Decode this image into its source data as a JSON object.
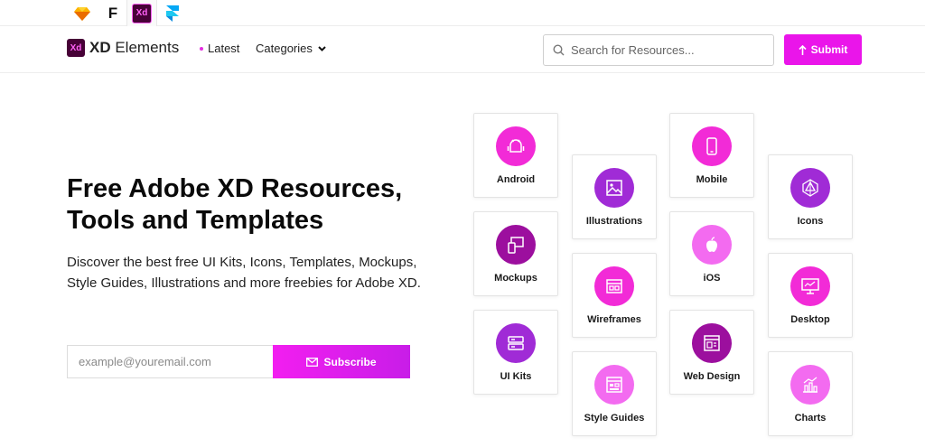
{
  "appbar": {
    "tabs": [
      {
        "name": "sketch",
        "glyph": "◆"
      },
      {
        "name": "figma-f",
        "glyph": "F"
      },
      {
        "name": "xd",
        "glyph": "Xd"
      },
      {
        "name": "framer",
        "glyph": "▶"
      }
    ]
  },
  "header": {
    "logo_badge": "Xd",
    "logo_bold": "XD",
    "logo_rest": " Elements",
    "nav_latest": "Latest",
    "nav_categories": "Categories",
    "search_placeholder": "Search for Resources...",
    "submit_label": "Submit"
  },
  "hero": {
    "title_line1": "Free Adobe XD Resources,",
    "title_line2": "Tools and Templates",
    "description": "Discover the best free UI Kits, Icons, Templates, Mockups, Style Guides, Illustrations and more freebies for Adobe XD.",
    "email_placeholder": "example@youremail.com",
    "subscribe_label": "Subscribe"
  },
  "colors": {
    "accent": "#ea15ea",
    "circle_pink": "#f22bd7",
    "circle_purple": "#a02bd6",
    "circle_deep": "#9c0f9e",
    "circle_light": "#f36bf0"
  },
  "categories": [
    {
      "label": "Android",
      "icon": "android-icon"
    },
    {
      "label": "Illustrations",
      "icon": "image-icon"
    },
    {
      "label": "Mobile",
      "icon": "mobile-icon"
    },
    {
      "label": "Icons",
      "icon": "geometric-icon"
    },
    {
      "label": "Mockups",
      "icon": "devices-icon"
    },
    {
      "label": "iOS",
      "icon": "apple-icon"
    },
    {
      "label": "Wireframes",
      "icon": "wireframe-icon"
    },
    {
      "label": "Desktop",
      "icon": "desktop-icon"
    },
    {
      "label": "UI Kits",
      "icon": "layers-icon"
    },
    {
      "label": "Web Design",
      "icon": "browser-icon"
    },
    {
      "label": "Style Guides",
      "icon": "palette-icon"
    },
    {
      "label": "Charts",
      "icon": "chart-icon"
    }
  ]
}
